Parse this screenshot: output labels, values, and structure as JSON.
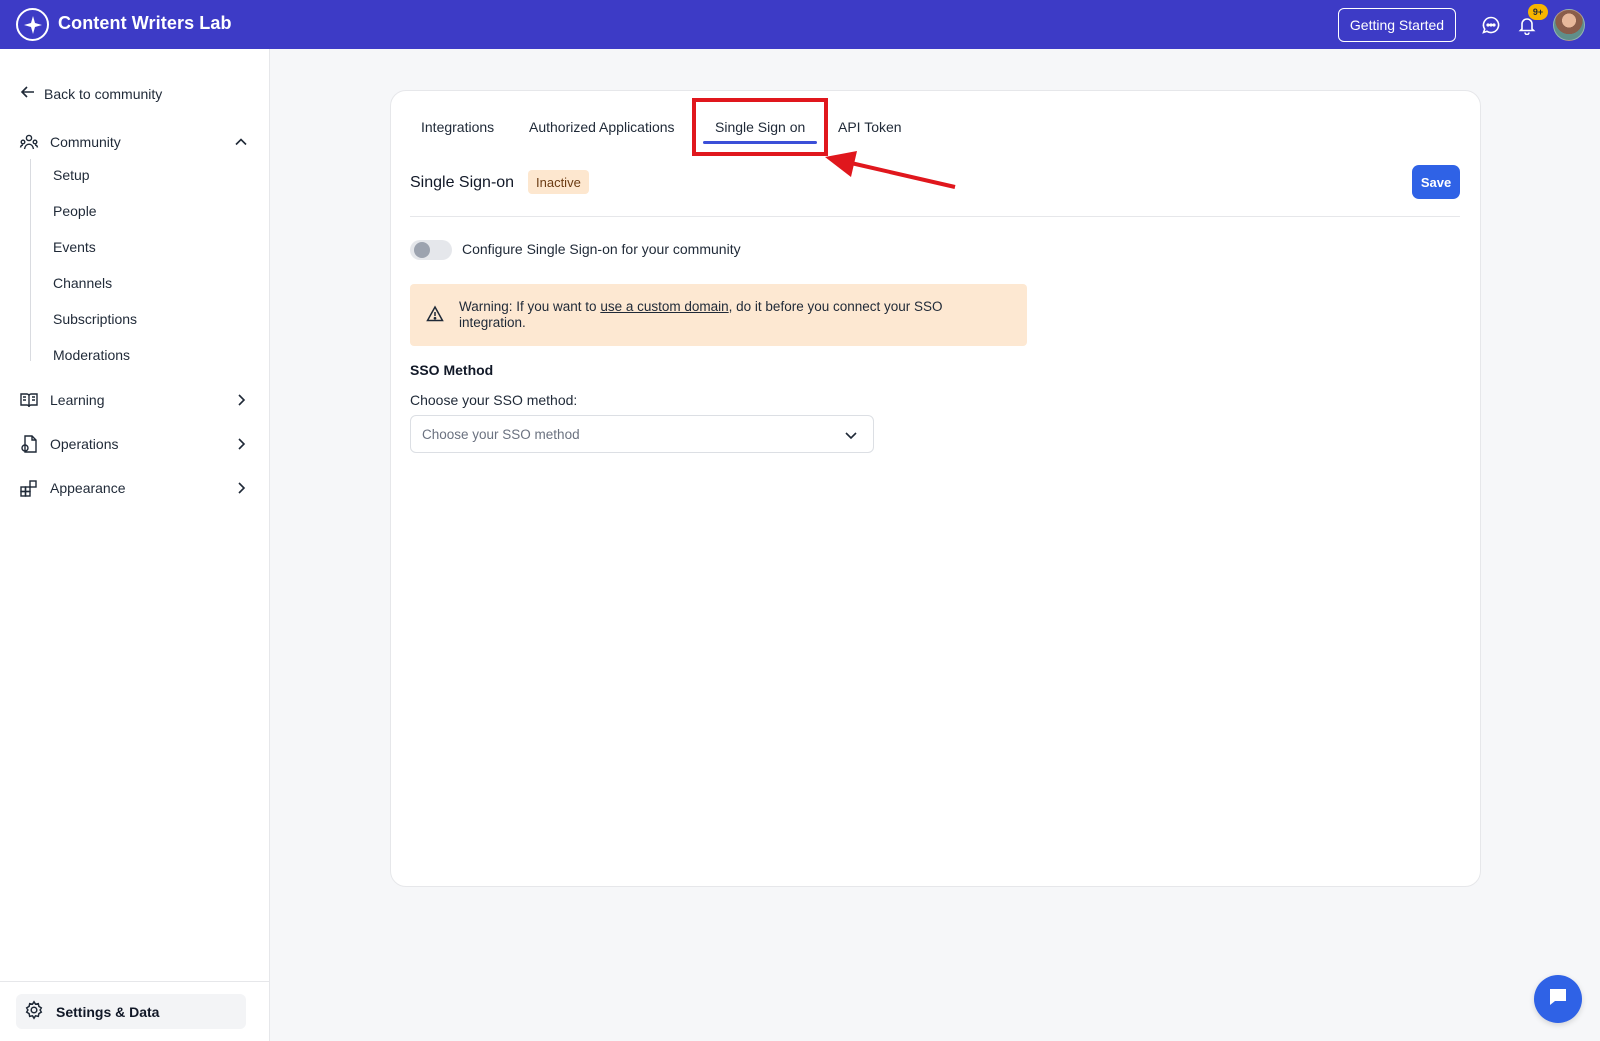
{
  "app": {
    "title": "Content Writers Lab",
    "brand_color": "#3d3bc6"
  },
  "topbar": {
    "getting_started_label": "Getting Started",
    "notification_count": "9+"
  },
  "sidebar": {
    "back_label": "Back to community",
    "community": {
      "label": "Community",
      "expanded": true,
      "items": [
        "Setup",
        "People",
        "Events",
        "Channels",
        "Subscriptions",
        "Moderations"
      ]
    },
    "sections": [
      {
        "label": "Learning",
        "icon": "book-icon"
      },
      {
        "label": "Operations",
        "icon": "operations-icon"
      },
      {
        "label": "Appearance",
        "icon": "appearance-icon"
      }
    ],
    "settings_label": "Settings & Data"
  },
  "tabs": [
    {
      "label": "Integrations",
      "active": false
    },
    {
      "label": "Authorized Applications",
      "active": false
    },
    {
      "label": "Single Sign on",
      "active": true
    },
    {
      "label": "API Token",
      "active": false
    }
  ],
  "sso": {
    "title": "Single Sign-on",
    "status": "Inactive",
    "save_label": "Save",
    "toggle_label": "Configure Single Sign-on for your community",
    "toggle_on": false,
    "warning": {
      "prefix": "Warning: If you want to ",
      "link": "use a custom domain",
      "suffix": ", do it before you connect your SSO integration."
    },
    "method_heading": "SSO Method",
    "method_label": "Choose your SSO method:",
    "method_placeholder": "Choose your SSO method"
  },
  "colors": {
    "accent": "#2f62e6",
    "highlight": "#e0171d",
    "warning_bg": "#fde8d2"
  }
}
